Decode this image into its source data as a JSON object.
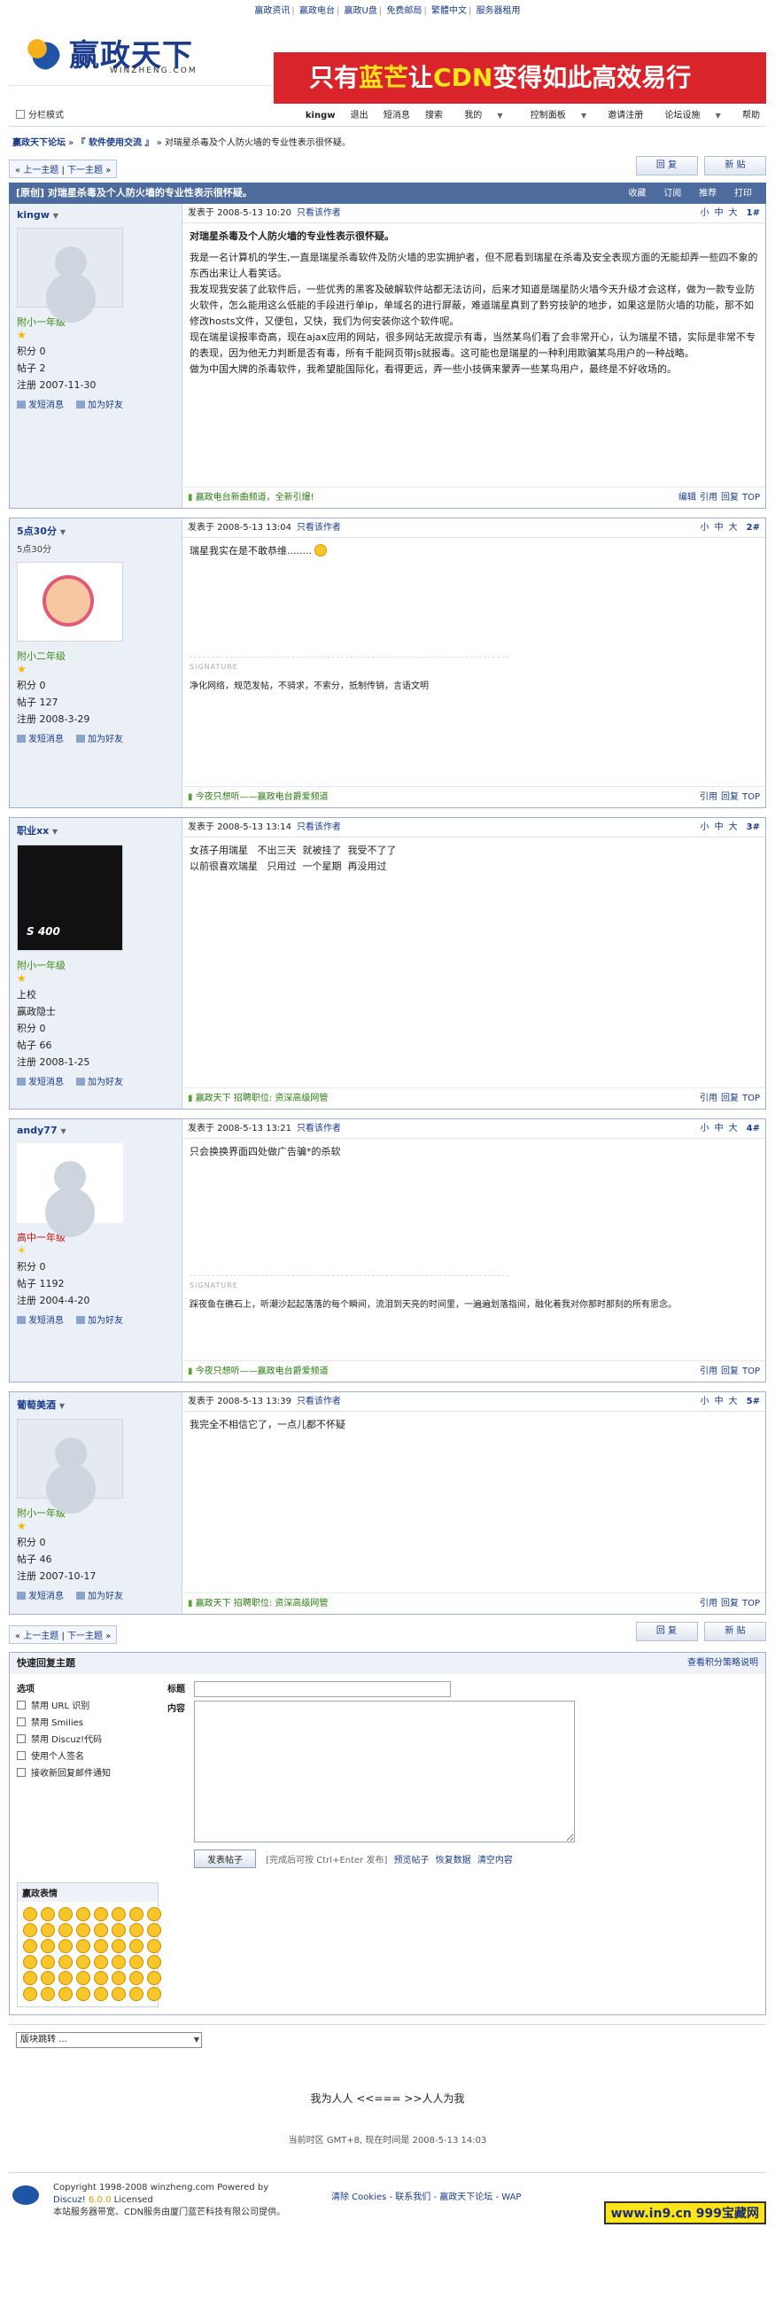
{
  "top_links": [
    "赢政资讯",
    "赢政电台",
    "赢政U盘",
    "免费邮局",
    "赢政U盘",
    "繁體中文",
    "服务器租用"
  ],
  "header": {
    "logo_text": "赢政天下",
    "logo_domain": "WINZHENG.COM",
    "banner_pre": "只有",
    "banner_hl1": "蓝芒",
    "banner_mid": "让",
    "banner_hl2": "CDN",
    "banner_post": "变得如此高效易行"
  },
  "navbar": {
    "classic": "分栏模式",
    "items": [
      "kingw",
      "退出",
      "短消息",
      "搜索",
      "我的",
      "控制面板",
      "邀请注册",
      "论坛设施",
      "帮助"
    ]
  },
  "breadcrumb": {
    "forum": "赢政天下论坛",
    "section": "『 软件使用交流 』",
    "thread": "对瑞星杀毒及个人防火墙的专业性表示很怀疑。"
  },
  "pages": {
    "prev": "上一主题",
    "next": "下一主题",
    "reply_btn": "回 复",
    "new_btn": "新 贴"
  },
  "thread": {
    "title": "[原创] 对瑞星杀毒及个人防火墙的专业性表示很怀疑。",
    "actions": [
      "收藏",
      "订阅",
      "推荐",
      "打印"
    ]
  },
  "labels": {
    "posted_at": "发表于",
    "only_author": "只看该作者",
    "font_sizes": [
      "小",
      "中",
      "大"
    ],
    "signature": "SIGNATURE",
    "send_msg": "发短消息",
    "add_friend": "加为好友",
    "points": "积分",
    "posts": "帖子",
    "registered": "注册",
    "edit": "编辑",
    "quote": "引用",
    "reply": "回复",
    "top": "TOP"
  },
  "posts": [
    {
      "author": "kingw",
      "rank": "附小一年级",
      "points": "0",
      "posts": "2",
      "reg": "2007-11-30",
      "time": "2008-5-13 10:20",
      "floor": "1#",
      "title": "对瑞星杀毒及个人防火墙的专业性表示很怀疑。",
      "body": [
        "我是一名计算机的学生,一直是瑞星杀毒软件及防火墙的忠实拥护者，但不愿看到瑞星在杀毒及安全表现方面的无能却弄一些四不象的东西出来让人看笑话。",
        "我发现我安装了此软件后，一些优秀的黑客及破解软件站都无法访问，后来才知道是瑞星防火墙今天升级才会这样，做为一款专业防火软件，怎么能用这么低能的手段进行单ip，单域名的进行屏蔽，难道瑞星真到了黔穷技驴的地步，如果这是防火墙的功能，那不如修改hosts文件，又便包，又快，我们为何安装你这个软件呢。",
        "现在瑞星误报率奇高，现在ajax应用的网站，很多网站无故提示有毒，当然某鸟们看了会非常开心，认为瑞星不错，实际是非常不专的表现，因为他无力判断是否有毒，所有千能网页带js就报毒。这可能也是瑞星的一种利用欺骗某鸟用户的一种战略。",
        "做为中国大牌的杀毒软件，我希望能国际化，看得更远，弄一些小技俩来蒙弄一些某鸟用户，最终是不好收场的。"
      ],
      "ad": "赢政电台新曲频道，全新引爆!",
      "edit": true
    },
    {
      "author": "5点30分",
      "nick": "5点30分",
      "rank": "附小二年级",
      "points": "0",
      "posts": "127",
      "reg": "2008-3-29",
      "time": "2008-5-13 13:04",
      "floor": "2#",
      "body": [
        "瑞星我实在是不敢恭维........"
      ],
      "sig": "净化网络，规范发帖，不骑求，不索分，抵制传销，言语文明",
      "ad": "今夜只想听——赢政电台爵爱频道"
    },
    {
      "author": "职业xx",
      "rank": "附小一年级",
      "extra": "上校",
      "extra2": "赢政隐士",
      "points": "0",
      "posts": "66",
      "reg": "2008-1-25",
      "time": "2008-5-13 13:14",
      "floor": "3#",
      "body": [
        "女孩子用瑞星   不出三天  就被挂了  我受不了了",
        "以前很喜欢瑞星   只用过  一个星期  再没用过"
      ],
      "ad": "赢政天下 招聘职位: 资深高级网管"
    },
    {
      "author": "andy77",
      "rank": "高中一年级",
      "points": "0",
      "posts": "1192",
      "reg": "2004-4-20",
      "time": "2008-5-13 13:21",
      "floor": "4#",
      "body": [
        "只会换换界面四处做广告骗*的杀软"
      ],
      "sig": "踩夜鱼在礁石上，听潮沙起起落落的每个瞬间，流泪到天亮的时间里，一遍遍划落指间，融化着我对你那时那刻的所有思念。",
      "ad": "今夜只想听——赢政电台爵爱频道"
    },
    {
      "author": "葡萄美酒",
      "rank": "附小一年级",
      "points": "0",
      "posts": "46",
      "reg": "2007-10-17",
      "time": "2008-5-13 13:39",
      "floor": "5#",
      "body": [
        "我完全不相信它了，一点儿都不怀疑"
      ],
      "ad": "赢政天下 招聘职位: 资深高级网管"
    }
  ],
  "quickreply": {
    "header": "快速回复主题",
    "rules": "查看积分策略说明",
    "options_title": "选项",
    "options": [
      "禁用 URL 识别",
      "禁用 Smilies",
      "禁用 Discuz!代码",
      "使用个人签名",
      "接收新回复邮件通知"
    ],
    "title_label": "标题",
    "content_label": "内容",
    "submit": "发表帖子",
    "hint": "[完成后可按 Ctrl+Enter 发布]",
    "preview": "预览帖子",
    "restore": "恢复数据",
    "clear": "清空内容",
    "smilies_title": "赢政表情"
  },
  "jump": "版块跳转 ...",
  "slogan": "我为人人 <<=== >>人人为我",
  "timeinfo": "当前时区 GMT+8, 现在时间是 2008-5-13 14:03",
  "footer": {
    "copy": "Copyright 1998-2008 winzheng.com Powered by",
    "discuz": "Discuz!",
    "version": "6.0.0",
    "licensed": "Licensed",
    "line3": "本站服务器带宽、CDN服务由厦门蓝芒科技有限公司提供。",
    "links": "清除 Cookies - 联系我们 - 赢政天下论坛 - WAP",
    "watermark": "www.in9.cn 999宝藏网"
  }
}
